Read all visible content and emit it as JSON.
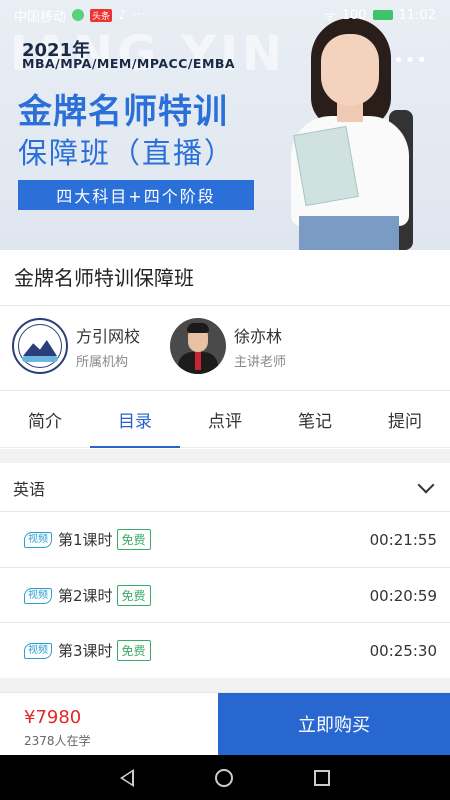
{
  "status_bar": {
    "carrier": "中国移动",
    "battery": "100",
    "time": "11:02"
  },
  "banner": {
    "bg_text": "IANG YIN",
    "year": "2021年",
    "subtitle": "MBA/MPA/MEM/MPACC/EMBA",
    "title_line1": "金牌名师特训",
    "title_line2": "保障班（直播）",
    "bar_text": "四大科目+四个阶段",
    "more_icon": "•••"
  },
  "course": {
    "title": "金牌名师特训保障班"
  },
  "institution": {
    "name": "方引网校",
    "role": "所属机构"
  },
  "teacher": {
    "name": "徐亦林",
    "role": "主讲老师"
  },
  "tabs": [
    {
      "label": "简介"
    },
    {
      "label": "目录"
    },
    {
      "label": "点评"
    },
    {
      "label": "笔记"
    },
    {
      "label": "提问"
    }
  ],
  "active_tab": 1,
  "section": {
    "title": "英语"
  },
  "lessons": [
    {
      "tag": "视频",
      "name": "第1课时",
      "free": "免费",
      "duration": "00:21:55"
    },
    {
      "tag": "视频",
      "name": "第2课时",
      "free": "免费",
      "duration": "00:20:59"
    },
    {
      "tag": "视频",
      "name": "第3课时",
      "free": "免费",
      "duration": "00:25:30"
    }
  ],
  "purchase": {
    "price": "¥7980",
    "students": "2378人在学",
    "buy_label": "立即购买"
  },
  "colors": {
    "accent": "#2a63c7",
    "price": "#e02a2a",
    "free_tag": "#3aaa6a",
    "video_tag": "#2b9fd0"
  }
}
